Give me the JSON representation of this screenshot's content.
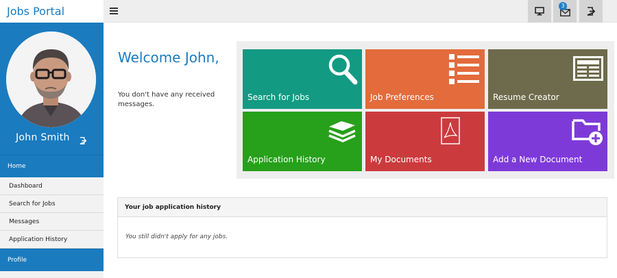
{
  "header": {
    "brand": "Jobs Portal",
    "message_count": "3"
  },
  "sidebar": {
    "user_name": "John Smith",
    "sections": [
      {
        "label": "Home"
      },
      {
        "label": "Profile"
      }
    ],
    "items": [
      {
        "label": "Dashboard"
      },
      {
        "label": "Search for Jobs"
      },
      {
        "label": "Messages"
      },
      {
        "label": "Application History"
      }
    ]
  },
  "main": {
    "welcome": "Welcome John,",
    "no_messages": "You don't have any received messages.",
    "tiles": [
      {
        "label": "Search for Jobs",
        "color": "#139a83",
        "icon": "search-icon"
      },
      {
        "label": "Job Preferences",
        "color": "#e36b3c",
        "icon": "list-icon"
      },
      {
        "label": "Resume Creator",
        "color": "#6d6b4b",
        "icon": "newspaper-icon"
      },
      {
        "label": "Application History",
        "color": "#27a01b",
        "icon": "stack-icon"
      },
      {
        "label": "My Documents",
        "color": "#cb3b3e",
        "icon": "pdf-document-icon"
      },
      {
        "label": "Add a New Document",
        "color": "#7e3ad8",
        "icon": "folder-add-icon"
      }
    ],
    "history_panel": {
      "title": "Your job application history",
      "empty_text": "You still didn't apply for any jobs."
    }
  }
}
